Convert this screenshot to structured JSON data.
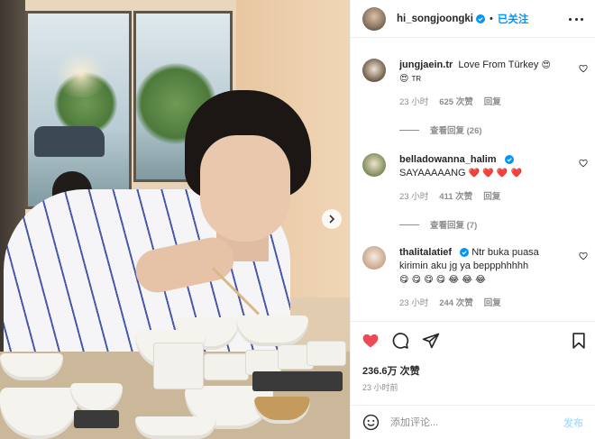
{
  "post": {
    "author": "hi_songjoongki",
    "follow_status": "已关注",
    "separator": "•",
    "likes": "236.6万 次赞",
    "time": "23 小时前"
  },
  "comments": [
    {
      "user": "jungjaein.tr",
      "text": "Love From Türkey",
      "emoji_line": "😍",
      "extra": "TR",
      "time": "23 小时",
      "likes": "625 次赞",
      "reply": "回复",
      "view_replies": "查看回复 (26)"
    },
    {
      "user": "belladowanna_halim",
      "text": "SAYAAAAANG",
      "emoji_line": "❤️ ❤️ ❤️ ❤️",
      "time": "23 小时",
      "likes": "411 次赞",
      "reply": "回复",
      "view_replies": "查看回复 (7)"
    },
    {
      "user": "thalitalatief",
      "text": "Ntr buka puasa kirimin aku jg ya beppphhhhh",
      "emoji_line": "😋 😋 😋 😋 😂 😂 😂",
      "time": "23 小时",
      "likes": "244 次赞",
      "reply": "回复"
    }
  ],
  "input": {
    "placeholder": "添加评论...",
    "post_label": "发布"
  },
  "icons": {
    "header_more": "more-horizontal-icon",
    "verified": "verified-badge-icon",
    "like": "heart-filled-icon",
    "comment": "comment-bubble-icon",
    "share": "paper-plane-icon",
    "save": "bookmark-icon",
    "emoji": "smiley-icon",
    "next": "chevron-right-icon"
  },
  "colors": {
    "accent": "#0095f6",
    "like": "#ed4956",
    "muted": "#8e8e8e",
    "post_disabled": "#b2dffc"
  }
}
